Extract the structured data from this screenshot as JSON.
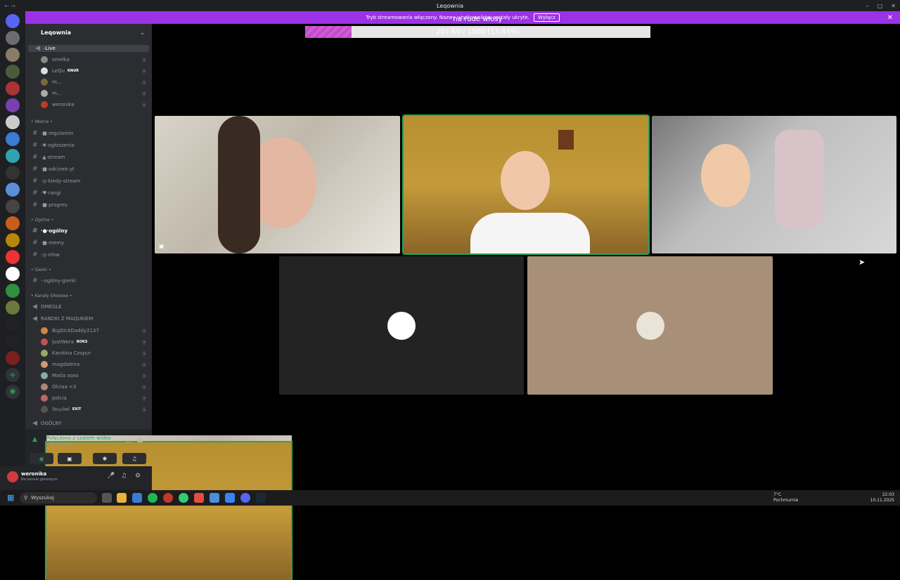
{
  "window": {
    "title": "Leqownia",
    "nav": "← →"
  },
  "stream_banner": {
    "text": "Tryb streamowania włączony. Nazwy użytkowników zostały ukryte.",
    "button": "Wyłącz"
  },
  "overlay": {
    "goal_title": "na rude włosy",
    "progress_text": "201.60 / 1500 (13.44%)",
    "progress_fraction": 0.1344
  },
  "server": {
    "name": "Leqownia"
  },
  "channels": [
    {
      "label": "-Live",
      "kind": "voice-active"
    },
    {
      "label": "smelka",
      "kind": "user"
    },
    {
      "label": "LeQu",
      "kind": "user",
      "tag": "KNUR"
    },
    {
      "label": "m...",
      "kind": "user"
    },
    {
      "label": "m...",
      "kind": "user"
    },
    {
      "label": "weronika",
      "kind": "user"
    },
    {
      "label": "• Ważne •",
      "kind": "category"
    },
    {
      "label": "·■·regulamin",
      "kind": "text"
    },
    {
      "label": "·✖·ogłoszenia",
      "kind": "text"
    },
    {
      "label": "·▲·stream",
      "kind": "text"
    },
    {
      "label": "·■·odcinek-yt",
      "kind": "text"
    },
    {
      "label": "·◎·kiedy-stream",
      "kind": "text"
    },
    {
      "label": "·♥·rangi",
      "kind": "text"
    },
    {
      "label": "·■·progres",
      "kind": "text"
    },
    {
      "label": "• Ogólne •",
      "kind": "category"
    },
    {
      "label": "·●·ogólny",
      "kind": "text-bold"
    },
    {
      "label": "·■·memy",
      "kind": "text"
    },
    {
      "label": "·◎·nfsw",
      "kind": "text"
    },
    {
      "label": "• Gierki •",
      "kind": "category"
    },
    {
      "label": "··ogólny-gierki",
      "kind": "text"
    },
    {
      "label": "• Kanały Głosowe •",
      "kind": "category"
    },
    {
      "label": "OMEGLE",
      "kind": "voice"
    },
    {
      "label": "RANDKI Z MAQUKIEM",
      "kind": "voice"
    },
    {
      "label": "BigDickDaddy2137",
      "kind": "user"
    },
    {
      "label": "JustWera",
      "kind": "user",
      "tag": "BOKS"
    },
    {
      "label": "Karolina Czopur",
      "kind": "user"
    },
    {
      "label": "magdalena",
      "kind": "user"
    },
    {
      "label": "Matia xoxo",
      "kind": "user"
    },
    {
      "label": "Olciaa <3",
      "kind": "user"
    },
    {
      "label": "polcia",
      "kind": "user"
    },
    {
      "label": "𝔅𝔬𝔠𝔷𝔢𝔩𝔬𝔞𝔩",
      "kind": "user",
      "tag": "EXIT"
    },
    {
      "label": "OGÓLNY",
      "kind": "voice"
    }
  ],
  "voice_panel": {
    "status": "Połączono z czatem wideo",
    "channel": "-Live / Leqownia"
  },
  "user_panel": {
    "name": "weronika",
    "status": "Na kanale głosowym"
  },
  "taskbar": {
    "search_placeholder": "Wyszukaj",
    "weather_temp": "7°C",
    "weather_desc": "Pochmurnie",
    "time": "22:03",
    "date": "10.11.2025"
  },
  "colors": {
    "accent": "#9b32e6",
    "speaking": "#23a55a",
    "progress": "#d05cd6"
  }
}
